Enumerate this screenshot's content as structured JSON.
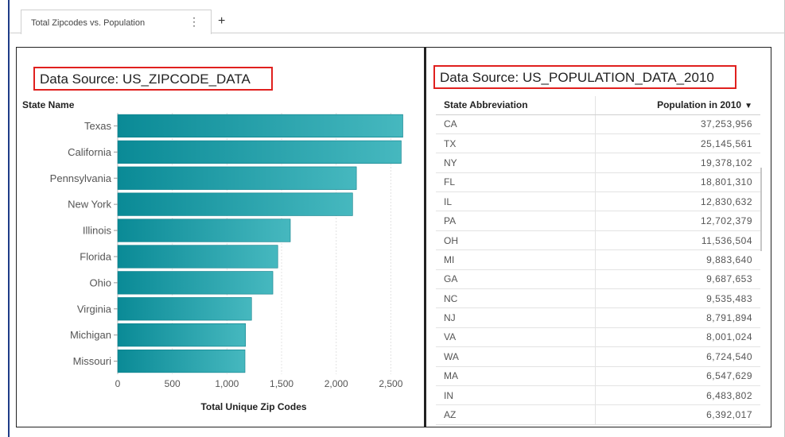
{
  "tab": {
    "label": "Total Zipcodes vs. Population",
    "menu_icon": "more-vertical-icon",
    "add_icon": "plus-icon"
  },
  "left_panel": {
    "title": "Data Source: US_ZIPCODE_DATA",
    "chart_data": {
      "type": "bar",
      "orientation": "horizontal",
      "ylabel": "State Name",
      "xlabel": "Total Unique Zip Codes",
      "categories": [
        "Texas",
        "California",
        "Pennsylvania",
        "New York",
        "Illinois",
        "Florida",
        "Ohio",
        "Virginia",
        "Michigan",
        "Missouri"
      ],
      "values": [
        2610,
        2595,
        2185,
        2150,
        1580,
        1465,
        1420,
        1225,
        1170,
        1165
      ],
      "xlim": [
        0,
        2650
      ],
      "xticks": [
        0,
        500,
        1000,
        1500,
        2000,
        2500
      ],
      "xtick_labels": [
        "0",
        "500",
        "1,000",
        "1,500",
        "2,000",
        "2,500"
      ],
      "grid": true,
      "colors": {
        "bar_start": "#0a8a96",
        "bar_end": "#46b8bf"
      }
    }
  },
  "right_panel": {
    "title": "Data Source: US_POPULATION_DATA_2010",
    "table": {
      "columns": [
        {
          "label": "State Abbreviation"
        },
        {
          "label": "Population in 2010",
          "sort_icon": "sort-descending-icon",
          "sort_glyph": "▼"
        }
      ],
      "rows": [
        {
          "state": "CA",
          "population": "37,253,956"
        },
        {
          "state": "TX",
          "population": "25,145,561"
        },
        {
          "state": "NY",
          "population": "19,378,102"
        },
        {
          "state": "FL",
          "population": "18,801,310"
        },
        {
          "state": "IL",
          "population": "12,830,632"
        },
        {
          "state": "PA",
          "population": "12,702,379"
        },
        {
          "state": "OH",
          "population": "11,536,504"
        },
        {
          "state": "MI",
          "population": "9,883,640"
        },
        {
          "state": "GA",
          "population": "9,687,653"
        },
        {
          "state": "NC",
          "population": "9,535,483"
        },
        {
          "state": "NJ",
          "population": "8,791,894"
        },
        {
          "state": "VA",
          "population": "8,001,024"
        },
        {
          "state": "WA",
          "population": "6,724,540"
        },
        {
          "state": "MA",
          "population": "6,547,629"
        },
        {
          "state": "IN",
          "population": "6,483,802"
        },
        {
          "state": "AZ",
          "population": "6,392,017"
        }
      ]
    }
  },
  "colors": {
    "highlight_border": "#e0201e",
    "frame_accent": "#1f3c88"
  }
}
